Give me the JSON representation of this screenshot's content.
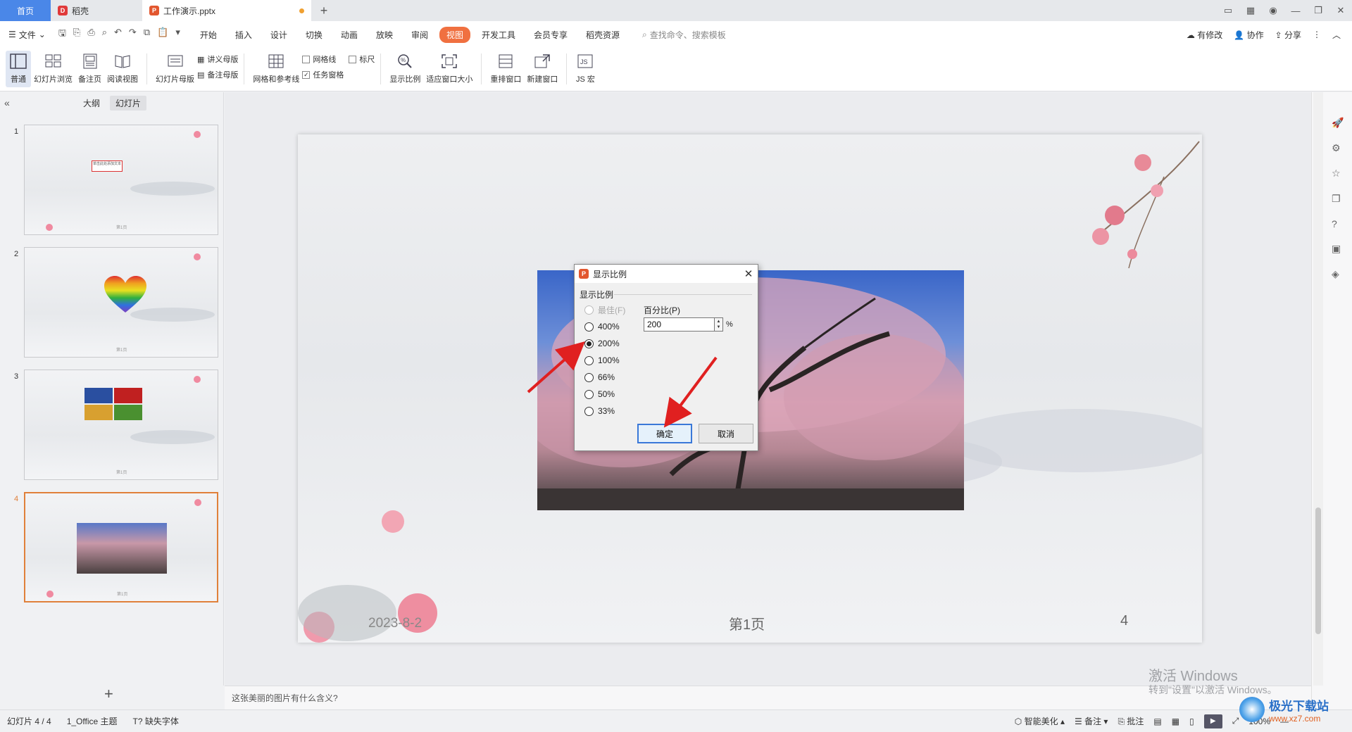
{
  "titlebar": {
    "home_tab": "首页",
    "docer_tab": "稻壳",
    "file_tab": "工作演示.pptx",
    "add_tab": "+"
  },
  "menu": {
    "file": "文件",
    "items": [
      "开始",
      "插入",
      "设计",
      "切换",
      "动画",
      "放映",
      "审阅",
      "视图",
      "开发工具",
      "会员专享",
      "稻壳资源"
    ],
    "active_index": 7,
    "search_placeholder": "查找命令、搜索模板",
    "right": [
      "有修改",
      "协作",
      "分享"
    ]
  },
  "ribbon": {
    "normal": "普通",
    "slide_sorter": "幻灯片浏览",
    "notes_page": "备注页",
    "reading_view": "阅读视图",
    "slide_master": "幻灯片母版",
    "handout_master": "讲义母版",
    "notes_master": "备注母版",
    "grid_guides": "网格和参考线",
    "gridlines": "网格线",
    "ruler": "标尺",
    "task_pane": "任务窗格",
    "zoom": "显示比例",
    "fit_window": "适应窗口大小",
    "arrange": "重排窗口",
    "new_window": "新建窗口",
    "js_macro": "JS 宏"
  },
  "left_panel": {
    "tab_outline": "大纲",
    "tab_slides": "幻灯片",
    "slides": [
      {
        "num": "1"
      },
      {
        "num": "2"
      },
      {
        "num": "3"
      },
      {
        "num": "4"
      }
    ],
    "add": "+"
  },
  "slide": {
    "date": "2023-8-2",
    "page_label": "第1页",
    "number": "4"
  },
  "notes": {
    "text": "这张美丽的图片有什么含义?"
  },
  "statusbar": {
    "slide_count": "幻灯片 4 / 4",
    "theme": "1_Office 主题",
    "missing_font": "缺失字体",
    "beautify": "智能美化",
    "notes": "备注",
    "comments": "批注",
    "zoom": "100%"
  },
  "watermark": {
    "line1": "激活 Windows",
    "line2": "转到\"设置\"以激活 Windows。",
    "site": "极光下载站",
    "site_url": "www.xz7.com"
  },
  "dialog": {
    "title": "显示比例",
    "group_label": "显示比例",
    "options": [
      "最佳(F)",
      "400%",
      "200%",
      "100%",
      "66%",
      "50%",
      "33%"
    ],
    "selected_index": 2,
    "percent_label": "百分比(P)",
    "percent_value": "200",
    "percent_unit": "%",
    "ok": "确定",
    "cancel": "取消"
  }
}
